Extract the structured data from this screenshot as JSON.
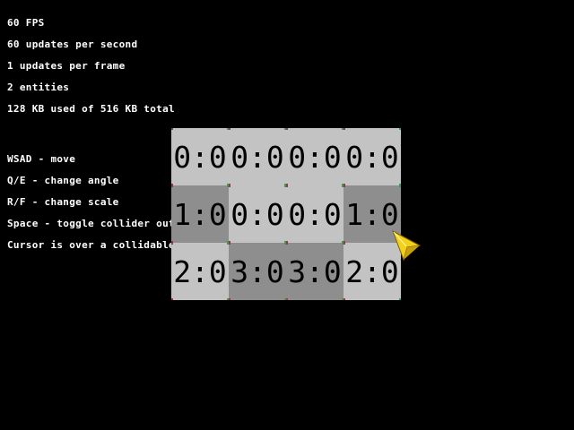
{
  "hud": {
    "fps": "60 FPS",
    "updates_per_second": "60 updates per second",
    "updates_per_frame": "1 updates per frame",
    "entities": "2 entities",
    "memory": "128 KB used of 516 KB total",
    "controls": [
      "WSAD - move",
      "Q/E - change angle",
      "R/F - change scale",
      "Space - toggle collider outlines"
    ],
    "cursor_status": "Cursor is over a collidable tile"
  },
  "tilemap": {
    "rows": [
      [
        {
          "label": "0:0",
          "shade": "light"
        },
        {
          "label": "0:0",
          "shade": "light"
        },
        {
          "label": "0:0",
          "shade": "light"
        },
        {
          "label": "0:0",
          "shade": "light"
        }
      ],
      [
        {
          "label": "1:0",
          "shade": "dark"
        },
        {
          "label": "0:0",
          "shade": "light"
        },
        {
          "label": "0:0",
          "shade": "light"
        },
        {
          "label": "1:0",
          "shade": "dark"
        }
      ],
      [
        {
          "label": "2:0",
          "shade": "light"
        },
        {
          "label": "3:0",
          "shade": "dark"
        },
        {
          "label": "3:0",
          "shade": "dark"
        },
        {
          "label": "2:0",
          "shade": "light"
        }
      ]
    ]
  },
  "colors": {
    "background": "#000000",
    "hud_text": "#ffffff",
    "tile_light": "#c3c3c3",
    "tile_dark": "#8e8e8e",
    "tile_label": "#000000",
    "corner_marker": "#b03030",
    "corner_marker_alt": "#30a060",
    "cursor_fill": "#f2d21a",
    "cursor_shade": "#c8a010",
    "cursor_outline": "#7a5e00"
  },
  "cursor": {
    "icon": "arrow-pointer-icon"
  }
}
